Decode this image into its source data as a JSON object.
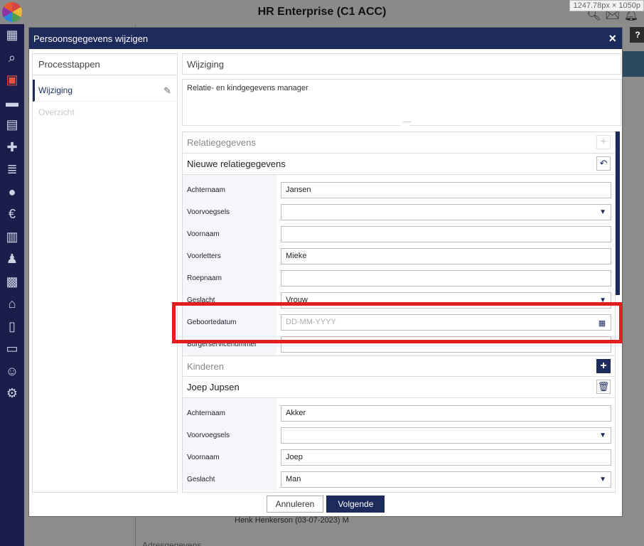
{
  "topbar": {
    "app_title": "HR Enterprise (C1 ACC)",
    "dimensions_label": "1247.78px × 1050p",
    "icons": [
      "search-icon",
      "mail-icon",
      "bell-icon",
      "user-icon"
    ]
  },
  "sidebar": {
    "icons": [
      "dashboard-icon",
      "search-icon",
      "id-card-icon",
      "folder-icon",
      "calendar-icon",
      "medical-icon",
      "report-icon",
      "money-bag-icon",
      "euro-icon",
      "schedule-icon",
      "person-icon",
      "badge-icon",
      "bank-icon",
      "document-icon",
      "document-list-icon",
      "handshake-icon",
      "gear-icon"
    ],
    "active_index": 2
  },
  "background": {
    "row_text": "Henk Henkerson (03-07-2023) M",
    "section_text": "Adresgegevens",
    "help_button": "?"
  },
  "modal": {
    "title": "Persoonsgegevens wijzigen",
    "close_label": "×",
    "steps": {
      "header": "Processtappen",
      "items": [
        {
          "label": "Wijziging",
          "state": "active"
        },
        {
          "label": "Overzicht",
          "state": "disabled"
        }
      ]
    },
    "change_title": "Wijziging",
    "description": "Relatie- en kindgegevens manager",
    "relation": {
      "section_title": "Relatiegegevens",
      "sub_title": "Nieuwe relatiegegevens",
      "fields": [
        {
          "label": "Achternaam",
          "value": "Jansen",
          "type": "text"
        },
        {
          "label": "Voorvoegsels",
          "value": "",
          "type": "select"
        },
        {
          "label": "Voornaam",
          "value": "",
          "type": "text"
        },
        {
          "label": "Voorletters",
          "value": "Mieke",
          "type": "text"
        },
        {
          "label": "Roepnaam",
          "value": "",
          "type": "text"
        },
        {
          "label": "Geslacht",
          "value": "Vrouw",
          "type": "select"
        },
        {
          "label": "Geboortedatum",
          "value": "",
          "placeholder": "DD-MM-YYYY",
          "type": "date"
        },
        {
          "label": "Burgerservicenummer",
          "value": "",
          "type": "text"
        }
      ]
    },
    "children": {
      "section_title": "Kinderen",
      "child_name": "Joep Jupsen",
      "fields": [
        {
          "label": "Achternaam",
          "value": "Akker",
          "type": "text"
        },
        {
          "label": "Voorvoegsels",
          "value": "",
          "type": "select"
        },
        {
          "label": "Voornaam",
          "value": "Joep",
          "type": "text"
        },
        {
          "label": "Geslacht",
          "value": "Man",
          "type": "select"
        }
      ]
    },
    "buttons": {
      "cancel": "Annuleren",
      "next": "Volgende"
    }
  },
  "colors": {
    "navy": "#1d2a5c",
    "highlight": "#e02020",
    "sidebar": "#1b1e4a"
  }
}
